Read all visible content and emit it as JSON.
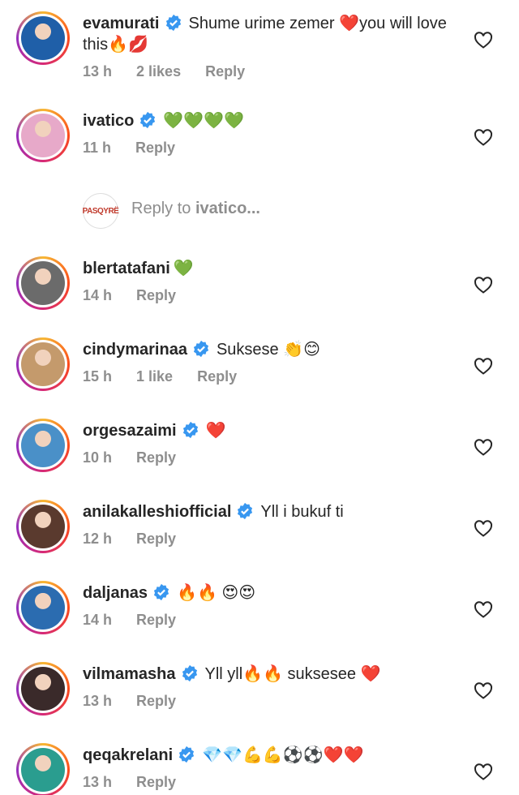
{
  "comments": [
    {
      "username": "evamurati",
      "verified": true,
      "text": "Shume urime zemer ❤️you will love this🔥💋",
      "time": "13 h",
      "likes": "2 likes",
      "reply": "Reply",
      "avatar_color": "#1f5fa8"
    },
    {
      "username": "ivatico",
      "verified": true,
      "text": "💚💚💚💚",
      "time": "11 h",
      "likes": "",
      "reply": "Reply",
      "avatar_color": "#e7a9c9"
    },
    {
      "username": "blertatafani",
      "verified": false,
      "text": "💚",
      "time": "14 h",
      "likes": "",
      "reply": "Reply",
      "avatar_color": "#6b6b6b"
    },
    {
      "username": "cindymarinaa",
      "verified": true,
      "text": "Suksese 👏😊",
      "time": "15 h",
      "likes": "1 like",
      "reply": "Reply",
      "avatar_color": "#c49a6c"
    },
    {
      "username": "orgesazaimi",
      "verified": true,
      "text": "❤️",
      "time": "10 h",
      "likes": "",
      "reply": "Reply",
      "avatar_color": "#4a90c8"
    },
    {
      "username": "anilakalleshiofficial",
      "verified": true,
      "text": "Yll i bukuf ti",
      "time": "12 h",
      "likes": "",
      "reply": "Reply",
      "avatar_color": "#5a3a2e"
    },
    {
      "username": "daljanas",
      "verified": true,
      "text": "🔥🔥 😍😍",
      "time": "14 h",
      "likes": "",
      "reply": "Reply",
      "avatar_color": "#2b6cb0"
    },
    {
      "username": "vilmamasha",
      "verified": true,
      "text": "Yll yll🔥🔥 suksesee ❤️",
      "time": "13 h",
      "likes": "",
      "reply": "Reply",
      "avatar_color": "#3a2a2a"
    },
    {
      "username": "qeqakrelani",
      "verified": true,
      "text": "💎💎💪💪⚽⚽❤️❤️",
      "time": "13 h",
      "likes": "",
      "reply": "Reply",
      "avatar_color": "#2a9d8f"
    }
  ],
  "reply_box": {
    "avatar_text": "PASQYRË",
    "prefix": "Reply to",
    "target": "ivatico..."
  },
  "colors": {
    "verified_blue": "#3897f0",
    "meta_gray": "#8e8e8e"
  }
}
